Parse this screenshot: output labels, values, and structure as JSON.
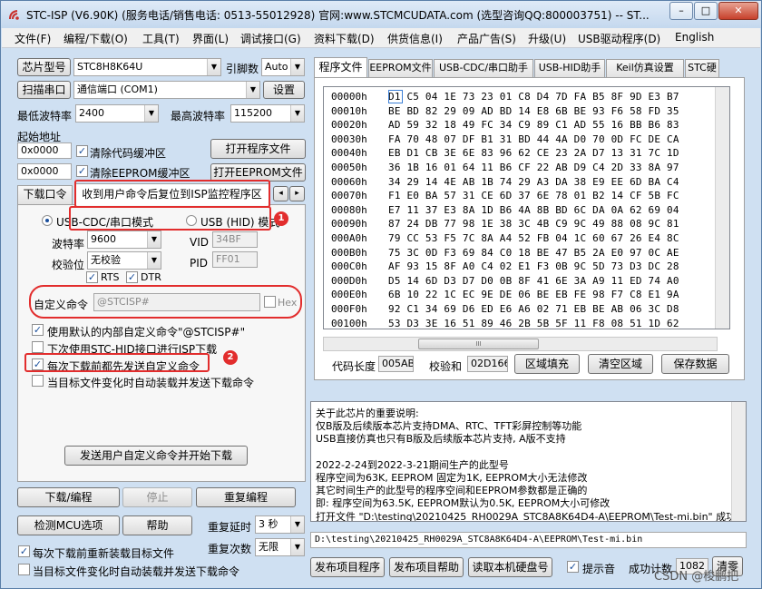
{
  "window": {
    "title": "STC-ISP (V6.90K) (服务电话/销售电话: 0513-55012928) 官网:www.STCMCUDATA.com (选型咨询QQ:800003751) -- ST...",
    "minimize": "–",
    "maximize": "□",
    "close": "✕"
  },
  "menu": [
    "文件(F)",
    "编程/下载(O)",
    "工具(T)",
    "界面(L)",
    "调试接口(G)",
    "资料下载(D)",
    "供货信息(I)",
    "产品广告(S)",
    "升级(U)",
    "USB驱动程序(D)",
    "English"
  ],
  "left": {
    "chip_model_btn": "芯片型号",
    "chip_model": "STC8H8K64U",
    "pin_count_label": "引脚数",
    "pin_count": "Auto",
    "scan_port_btn": "扫描串口",
    "comm_port": "通信端口 (COM1)",
    "settings_btn": "设置",
    "min_baud_label": "最低波特率",
    "min_baud": "2400",
    "max_baud_label": "最高波特率",
    "max_baud": "115200",
    "start_addr_label": "起始地址",
    "code_addr": "0x0000",
    "clear_code_buf": "清除代码缓冲区",
    "open_program_btn": "打开程序文件",
    "eeprom_addr": "0x0000",
    "clear_eeprom_buf": "清除EEPROM缓冲区",
    "open_eeprom_btn": "打开EEPROM文件",
    "tabs": [
      "下载口令",
      "收到用户命令后复位到ISP监控程序区"
    ],
    "tab_scroll_left": "◂",
    "tab_scroll_right": "▸",
    "usb_cdc_mode": "USB-CDC/串口模式",
    "usb_hid_mode": "USB (HID) 模式",
    "baud_label": "波特率",
    "baud": "9600",
    "parity_label": "校验位",
    "parity": "无校验",
    "vid_label": "VID",
    "vid": "34BF",
    "pid_label": "PID",
    "pid": "FF01",
    "rts_label": "RTS",
    "dtr_label": "DTR",
    "custom_cmd_label": "自定义命令",
    "custom_cmd_value": "@STCISP#",
    "hex_label": "Hex",
    "opt_default_cmd": "使用默认的内部自定义命令\"@STCISP#\"",
    "opt_stc_hid": "下次使用STC-HID接口进行ISP下载",
    "opt_send_before_download": "每次下载前都先发送自定义命令",
    "opt_auto_load": "当目标文件变化时自动装载并发送下载命令",
    "send_and_download_btn": "发送用户自定义命令并开始下载",
    "download_btn": "下载/编程",
    "stop_btn": "停止",
    "reprogram_btn": "重复编程",
    "detect_mcu_btn": "检测MCU选项",
    "help_btn": "帮助",
    "repeat_delay_label": "重复延时",
    "repeat_delay": "3 秒",
    "repeat_count_label": "重复次数",
    "repeat_count": "无限",
    "reload_before_download": "每次下载前重新装载目标文件",
    "auto_send_on_change": "当目标文件变化时自动装载并发送下载命令"
  },
  "right": {
    "tabs": [
      "程序文件",
      "EEPROM文件",
      "USB-CDC/串口助手",
      "USB-HID助手",
      "Keil仿真设置",
      "STC硬"
    ],
    "hex_rows": [
      {
        "addr": "00000h",
        "bytes": "D1 C5 04 1E 73 23 01 C8 D4 7D FA B5 8F 9D E3 B7"
      },
      {
        "addr": "00010h",
        "bytes": "BE BD 82 29 09 AD BD 14 E8 6B BE 93 F6 58 FD 35"
      },
      {
        "addr": "00020h",
        "bytes": "AD 59 32 18 49 FC 34 C9 89 C1 AD 55 16 BB B6 83"
      },
      {
        "addr": "00030h",
        "bytes": "FA 70 48 07 DF B1 31 BD 44 4A D0 70 0D FC DE CA"
      },
      {
        "addr": "00040h",
        "bytes": "EB D1 CB 3E 6E 83 96 62 CE 23 2A D7 13 31 7C 1D"
      },
      {
        "addr": "00050h",
        "bytes": "36 1B 16 01 64 11 B6 CF 22 AB D9 C4 2D 33 8A 97"
      },
      {
        "addr": "00060h",
        "bytes": "34 29 14 4E AB 1B 74 29 A3 DA 38 E9 EE 6D BA C4"
      },
      {
        "addr": "00070h",
        "bytes": "F1 E0 BA 57 31 CE 6D 37 6E 78 01 B2 14 CF 5B FC"
      },
      {
        "addr": "00080h",
        "bytes": "E7 11 37 E3 8A 1D B6 4A 8B BD 6C DA 0A 62 69 04"
      },
      {
        "addr": "00090h",
        "bytes": "87 24 DB 77 98 1E 38 3C 4B C9 9C 49 88 08 9C 81"
      },
      {
        "addr": "000A0h",
        "bytes": "79 CC 53 F5 7C 8A A4 52 FB 04 1C 60 67 26 E4 8C"
      },
      {
        "addr": "000B0h",
        "bytes": "75 3C 0D F3 69 84 C0 18 BE 47 B5 2A E0 97 0C AE"
      },
      {
        "addr": "000C0h",
        "bytes": "AF 93 15 8F A0 C4 02 E1 F3 0B 9C 5D 73 D3 DC 28"
      },
      {
        "addr": "000D0h",
        "bytes": "D5 14 6D D3 D7 D0 0B 8F 41 6E 3A A9 11 ED 74 A0"
      },
      {
        "addr": "000E0h",
        "bytes": "6B 10 22 1C EC 9E DE 06 BE EB FE 98 F7 C8 E1 9A"
      },
      {
        "addr": "000F0h",
        "bytes": "92 C1 34 69 D6 ED E6 A6 02 71 EB BE AB 06 3C D8"
      },
      {
        "addr": "00100h",
        "bytes": "53 D3 3E 16 51 89 46 2B 5B 5F 11 F8 08 51 1D 62"
      }
    ],
    "hscroll_thumb": "III",
    "code_length_label": "代码长度",
    "code_length": "005AB",
    "checksum_label": "校验和",
    "checksum": "02D166",
    "fill_area_btn": "区域填充",
    "clear_area_btn": "清空区域",
    "save_data_btn": "保存数据",
    "log_lines": [
      "关于此芯片的重要说明:",
      "  仅B版及后续版本芯片支持DMA、RTC、TFT彩屏控制等功能",
      "  USB直接仿真也只有B版及后续版本芯片支持, A版不支持",
      "",
      "  2022-2-24到2022-3-21期间生产的此型号",
      "  程序空间为63K, EEPROM 固定为1K, EEPROM大小无法修改",
      "  其它时间生产的此型号的程序空间和EEPROM参数都是正确的",
      "  即: 程序空间为63.5K, EEPROM默认为0.5K, EEPROM大小可修改",
      "打开文件 \"D:\\testing\\20210425_RH0029A_STC8A8K64D4-A\\EEPROM\\Test-mi.bin\" 成功"
    ],
    "file_path": "D:\\testing\\20210425_RH0029A_STC8A8K64D4-A\\EEPROM\\Test-mi.bin",
    "publish_program_btn": "发布项目程序",
    "publish_help_btn": "发布项目帮助",
    "read_disk_btn": "读取本机硬盘号",
    "beep_label": "提示音",
    "success_count_label": "成功计数",
    "success_count": "1082",
    "clear_btn": "清零"
  },
  "annotations": {
    "badge1": "1",
    "badge2": "2"
  },
  "watermark": "CSDN @梭鹏把",
  "colors": {
    "annotation_red": "#e22d2d",
    "accent_blue": "#1a4f9c"
  }
}
